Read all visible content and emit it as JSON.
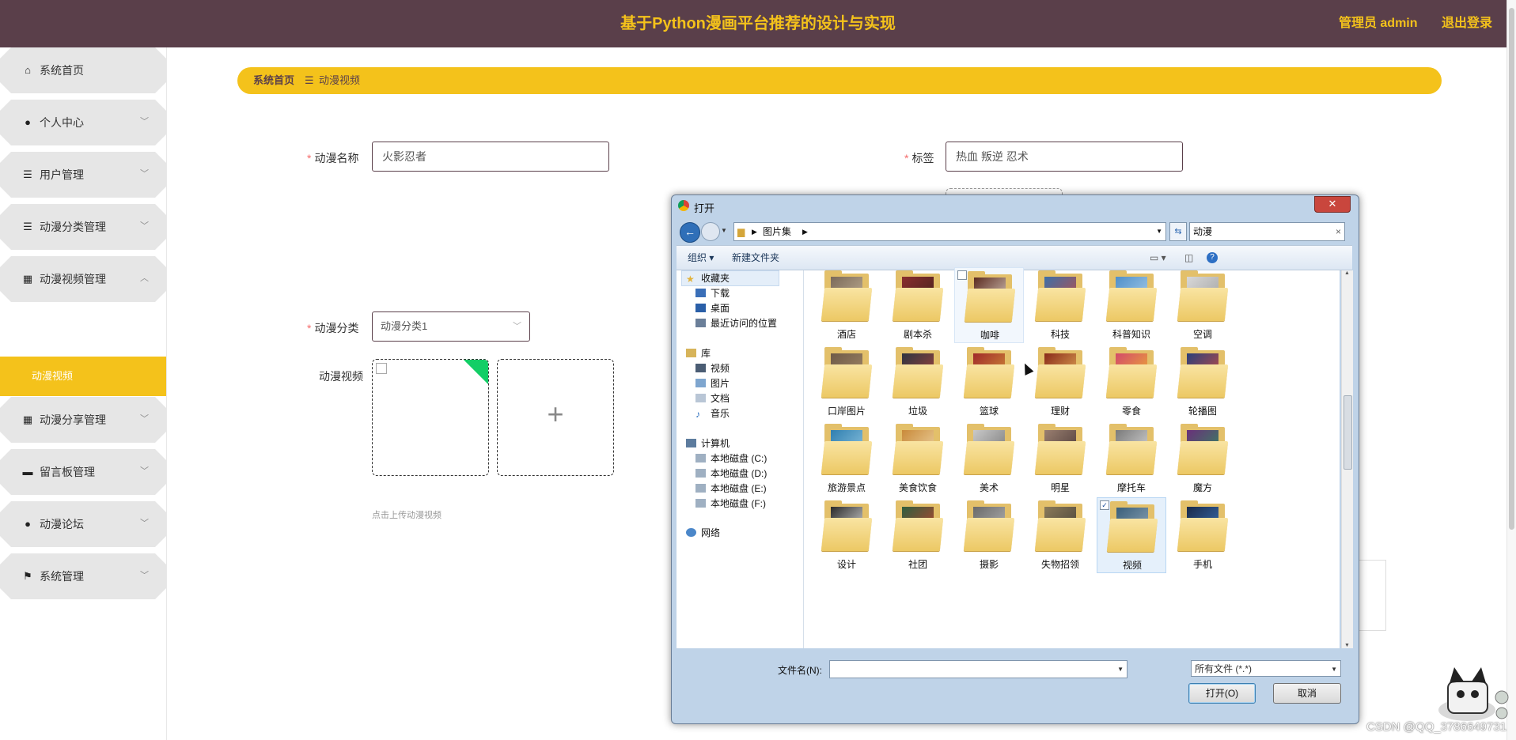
{
  "header": {
    "title": "基于Python漫画平台推荐的设计与实现",
    "user": "管理员 admin",
    "logout": "退出登录"
  },
  "sidebar": {
    "items": [
      {
        "label": "系统首页",
        "icon": "home-icon",
        "glyph": "⌂",
        "chevron": ""
      },
      {
        "label": "个人中心",
        "icon": "person-icon",
        "glyph": "●",
        "chevron": "﹀"
      },
      {
        "label": "用户管理",
        "icon": "list-icon",
        "glyph": "☰",
        "chevron": "﹀"
      },
      {
        "label": "动漫分类管理",
        "icon": "list-icon",
        "glyph": "☰",
        "chevron": "﹀"
      },
      {
        "label": "动漫视频管理",
        "icon": "grid-icon",
        "glyph": "▦",
        "chevron": "︿"
      },
      {
        "label": "动漫分享管理",
        "icon": "grid-icon",
        "glyph": "▦",
        "chevron": "﹀"
      },
      {
        "label": "留言板管理",
        "icon": "message-icon",
        "glyph": "▬",
        "chevron": "﹀"
      },
      {
        "label": "动漫论坛",
        "icon": "pin-icon",
        "glyph": "●",
        "chevron": "﹀"
      },
      {
        "label": "系统管理",
        "icon": "flag-icon",
        "glyph": "⚑",
        "chevron": "﹀"
      }
    ],
    "active_sub": "动漫视频"
  },
  "breadcrumb": {
    "home": "系统首页",
    "sep": "☰",
    "current": "动漫视频"
  },
  "form": {
    "name_label": "动漫名称",
    "name_value": "火影忍者",
    "tag_label": "标签",
    "tag_value": "热血 叛逆 忍术",
    "category_label": "动漫分类",
    "category_value": "动漫分类1",
    "video_label": "动漫视频",
    "upload_hint": "点击上传动漫视频",
    "plus": "+"
  },
  "dialog": {
    "title": "打开",
    "close": "✕",
    "path": "图片集",
    "search_value": "动漫",
    "organize": "组织 ▾",
    "new_folder": "新建文件夹",
    "nav": {
      "favorites": "收藏夹",
      "downloads": "下载",
      "desktop": "桌面",
      "recent": "最近访问的位置",
      "library": "库",
      "videos": "视频",
      "pictures": "图片",
      "documents": "文档",
      "music": "音乐",
      "computer": "计算机",
      "disk_c": "本地磁盘 (C:)",
      "disk_d": "本地磁盘 (D:)",
      "disk_e": "本地磁盘 (E:)",
      "disk_f": "本地磁盘 (F:)",
      "network": "网络"
    },
    "folders": [
      "酒店",
      "剧本杀",
      "咖啡",
      "科技",
      "科普知识",
      "空调",
      "口岸图片",
      "垃圾",
      "篮球",
      "理财",
      "零食",
      "轮播图",
      "旅游景点",
      "美食饮食",
      "美术",
      "明星",
      "摩托车",
      "魔方",
      "设计",
      "社团",
      "摄影",
      "失物招领",
      "视频",
      "手机"
    ],
    "filename_label": "文件名(N):",
    "filename_value": "",
    "filetype": "所有文件 (*.*)",
    "open": "打开(O)",
    "cancel": "取消"
  },
  "watermark": "CSDN @QQ_3786649731"
}
